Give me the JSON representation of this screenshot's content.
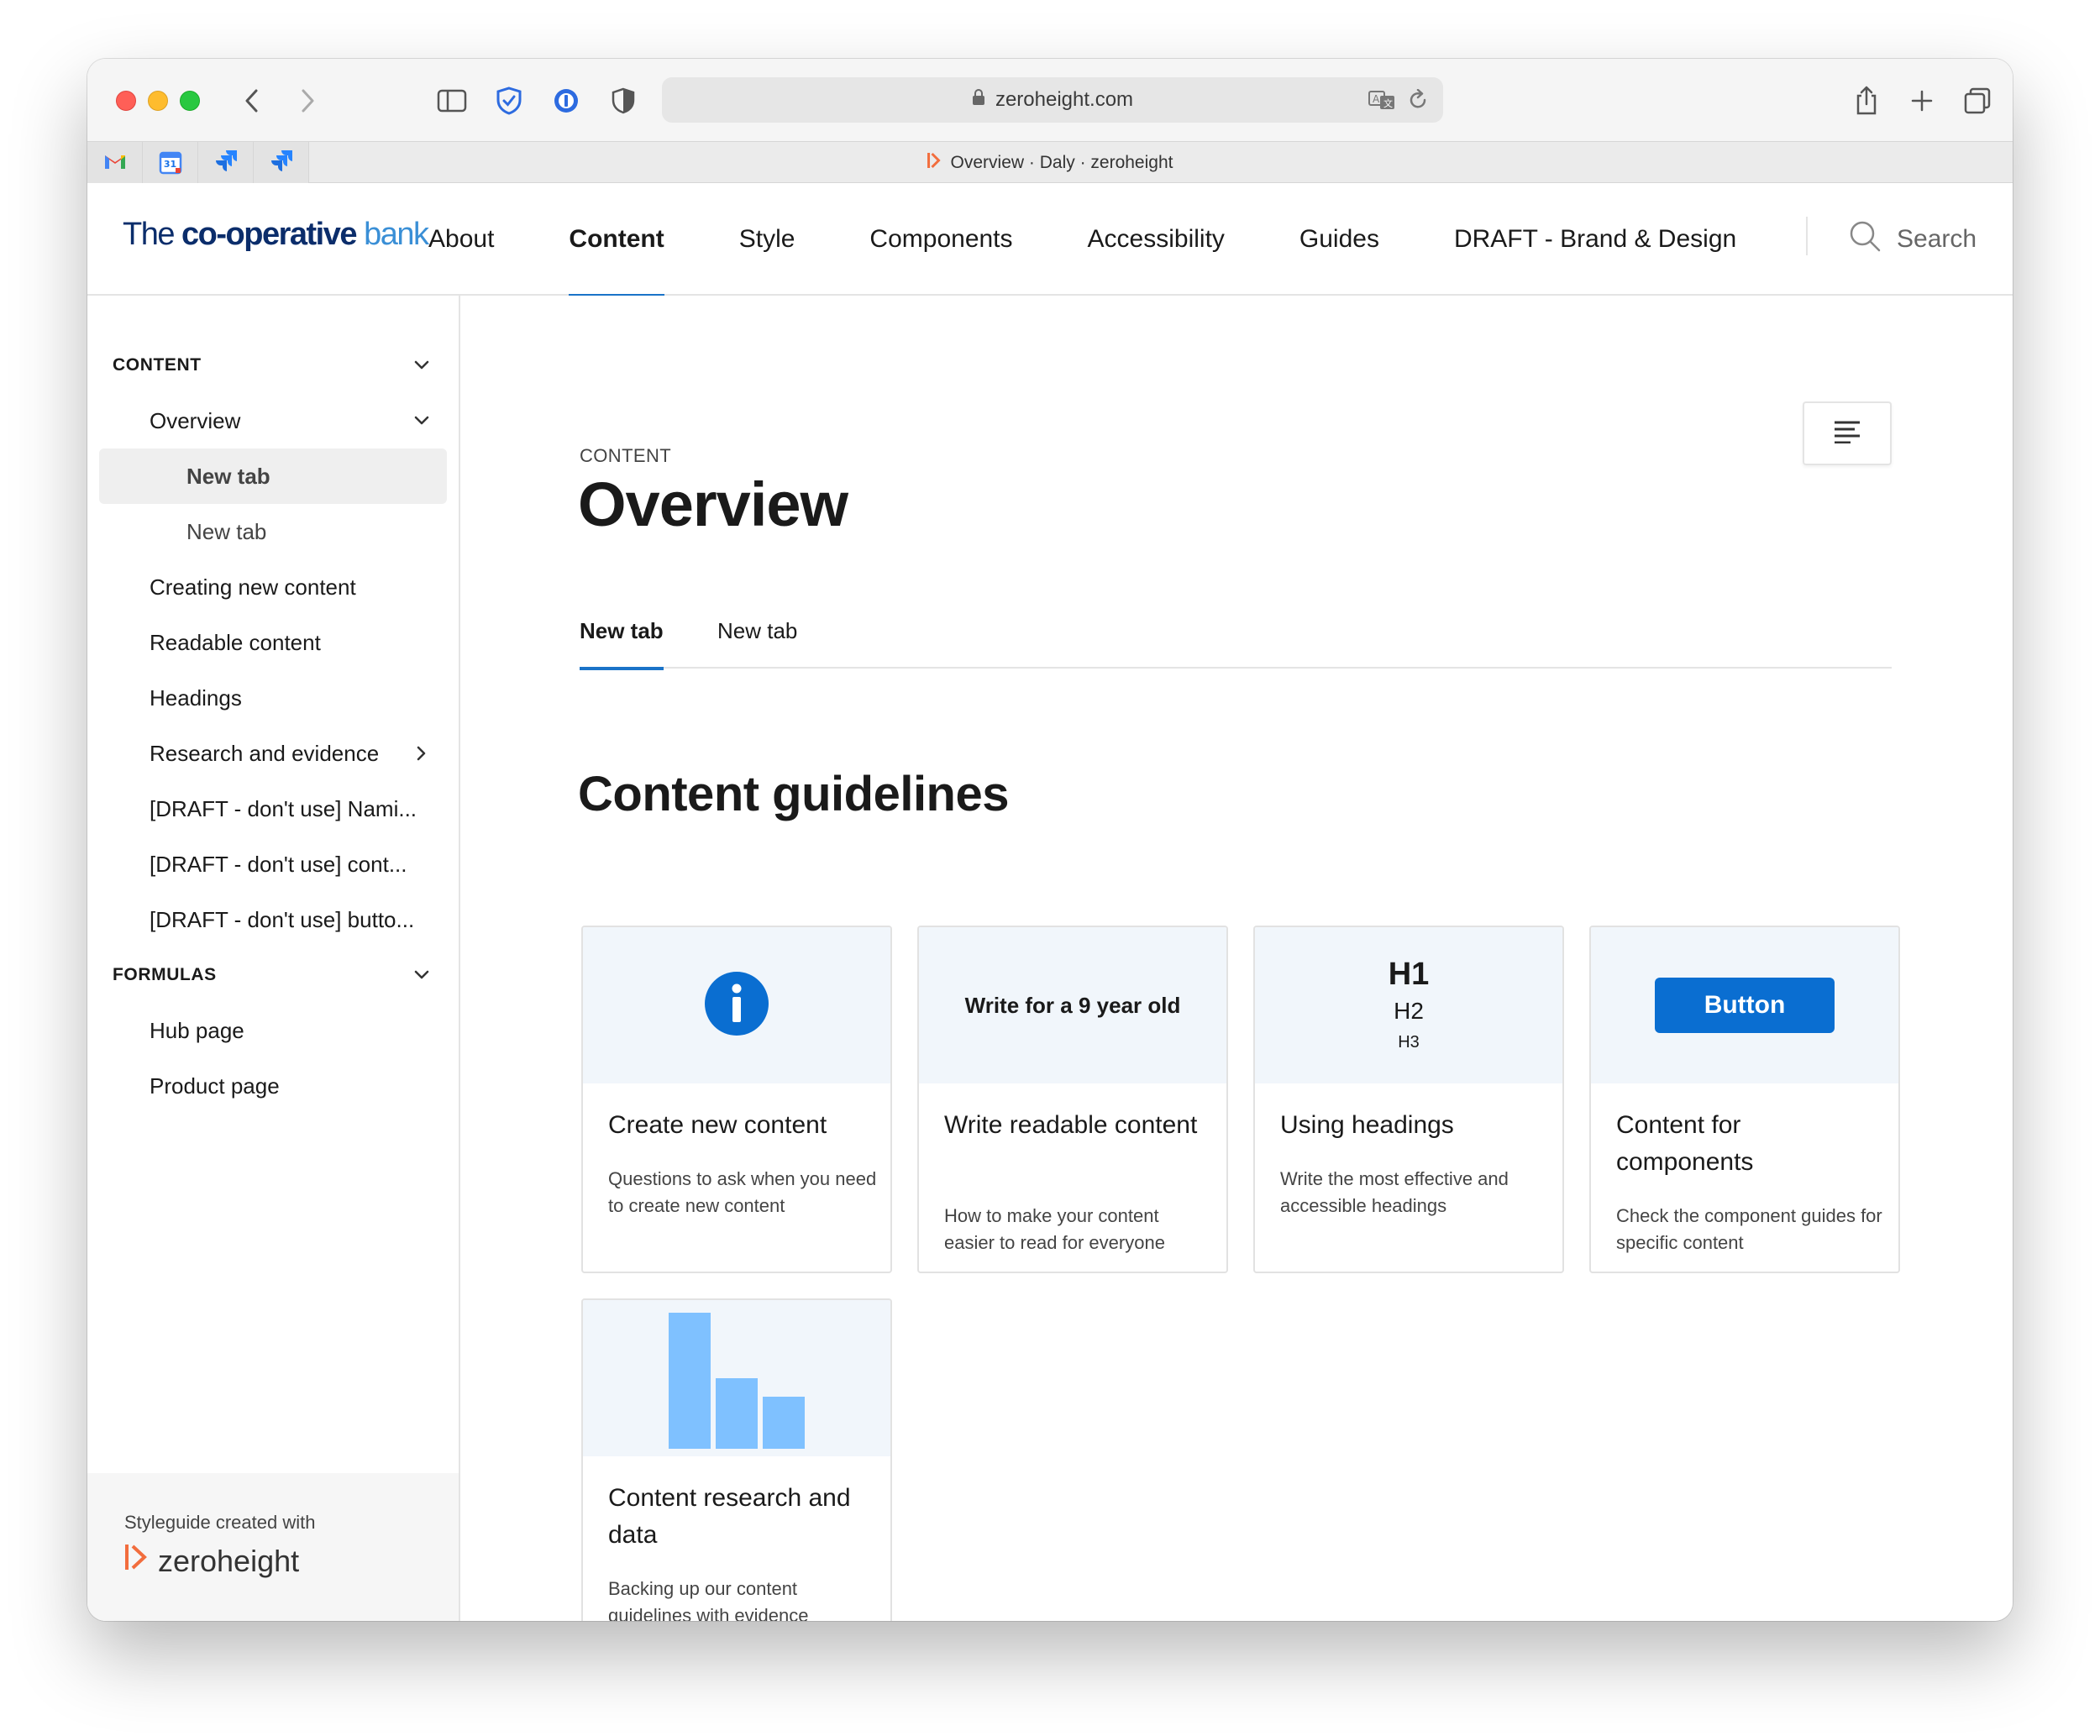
{
  "browser": {
    "url": "zeroheight.com",
    "tab_title": "Overview · Daly · zeroheight",
    "pinned_tabs": [
      "gmail-icon",
      "calendar-icon",
      "jira-icon",
      "jira-icon"
    ],
    "calendar_day": "31"
  },
  "header": {
    "logo": {
      "prefix": "The ",
      "bold": "co-operative",
      "suffix": " bank"
    },
    "nav": [
      {
        "label": "About"
      },
      {
        "label": "Content",
        "active": true
      },
      {
        "label": "Style"
      },
      {
        "label": "Components"
      },
      {
        "label": "Accessibility"
      },
      {
        "label": "Guides"
      },
      {
        "label": "DRAFT - Brand & Design"
      }
    ],
    "search_label": "Search"
  },
  "sidebar": {
    "items": [
      {
        "label": "CONTENT",
        "type": "section"
      },
      {
        "label": "Overview"
      },
      {
        "label": "New tab",
        "selected": true
      },
      {
        "label": "New tab"
      },
      {
        "label": "Creating new content"
      },
      {
        "label": "Readable content"
      },
      {
        "label": "Headings"
      },
      {
        "label": "Research and evidence"
      },
      {
        "label": "[DRAFT - don't use] Nami..."
      },
      {
        "label": "[DRAFT - don't use] cont..."
      },
      {
        "label": "[DRAFT - don't use] butto..."
      },
      {
        "label": "FORMULAS",
        "type": "section"
      },
      {
        "label": "Hub page"
      },
      {
        "label": "Product page"
      }
    ],
    "footer": {
      "caption": "Styleguide created with",
      "brand": "zeroheight"
    }
  },
  "main": {
    "eyebrow": "CONTENT",
    "title": "Overview",
    "tabs": [
      {
        "label": "New tab",
        "active": true
      },
      {
        "label": "New tab"
      }
    ],
    "section_title": "Content guidelines",
    "cards": [
      {
        "title": "Create new content",
        "desc": "Questions to ask when you need to create new content"
      },
      {
        "media_text": "Write for a 9 year old",
        "title": "Write readable content",
        "desc": "How to make your content easier to read for everyone"
      },
      {
        "media_h1": "H1",
        "media_h2": "H2",
        "media_h3": "H3",
        "title": "Using headings",
        "desc": "Write the most effective and accessible headings"
      },
      {
        "media_button": "Button",
        "title": "Content for components",
        "desc": "Check the component guides for specific content"
      },
      {
        "title": "Content research and data",
        "desc": "Backing up our content guidelines with evidence"
      }
    ]
  },
  "colors": {
    "accent": "#1a73c8",
    "primary_button": "#0a6ed1",
    "logo_navy": "#0b2d6b",
    "zeroheight_orange": "#f26d3d",
    "chart_blue": "#7fc1ff"
  }
}
